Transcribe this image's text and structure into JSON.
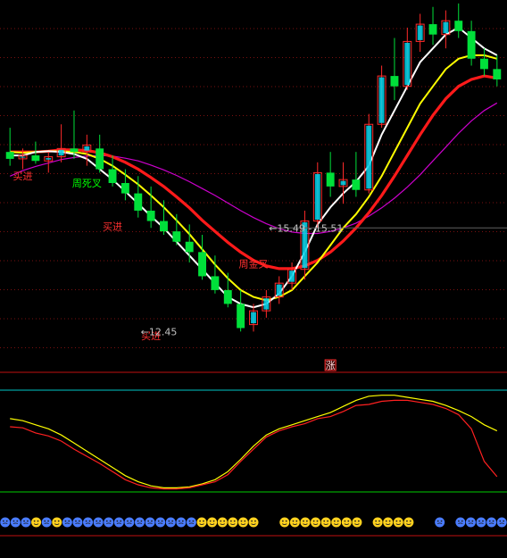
{
  "chart_data": [
    {
      "type": "candlestick",
      "panel": "main",
      "colors": {
        "up": "#ff2a2a",
        "down": "#00e03a",
        "up_bar_fill": "#00d8f0",
        "signal_bar": "#ffff00"
      },
      "candles": [
        {
          "o": 15.05,
          "h": 15.4,
          "l": 14.85,
          "c": 14.95
        },
        {
          "o": 14.95,
          "h": 15.1,
          "l": 14.8,
          "c": 15.0
        },
        {
          "o": 15.0,
          "h": 15.2,
          "l": 14.88,
          "c": 14.92
        },
        {
          "o": 14.92,
          "h": 15.05,
          "l": 14.75,
          "c": 14.98
        },
        {
          "o": 14.98,
          "h": 15.45,
          "l": 14.9,
          "c": 15.1
        },
        {
          "o": 15.1,
          "h": 15.65,
          "l": 14.95,
          "c": 15.05
        },
        {
          "o": 15.05,
          "h": 15.3,
          "l": 14.85,
          "c": 15.15
        },
        {
          "o": 15.1,
          "h": 15.3,
          "l": 14.75,
          "c": 14.8
        },
        {
          "o": 14.8,
          "h": 15.0,
          "l": 14.55,
          "c": 14.6
        },
        {
          "o": 14.6,
          "h": 14.8,
          "l": 14.35,
          "c": 14.45
        },
        {
          "o": 14.45,
          "h": 14.7,
          "l": 14.1,
          "c": 14.2
        },
        {
          "o": 14.2,
          "h": 14.55,
          "l": 13.95,
          "c": 14.05
        },
        {
          "o": 14.05,
          "h": 14.35,
          "l": 13.85,
          "c": 13.9
        },
        {
          "o": 13.9,
          "h": 14.15,
          "l": 13.7,
          "c": 13.75
        },
        {
          "o": 13.75,
          "h": 14.0,
          "l": 13.45,
          "c": 13.6
        },
        {
          "o": 13.6,
          "h": 13.85,
          "l": 13.2,
          "c": 13.25
        },
        {
          "o": 13.25,
          "h": 13.55,
          "l": 13.0,
          "c": 13.05
        },
        {
          "o": 13.05,
          "h": 13.3,
          "l": 12.8,
          "c": 12.85
        },
        {
          "o": 12.85,
          "h": 13.05,
          "l": 12.45,
          "c": 12.5
        },
        {
          "o": 12.55,
          "h": 12.85,
          "l": 12.45,
          "c": 12.75
        },
        {
          "o": 12.75,
          "h": 13.05,
          "l": 12.65,
          "c": 12.95
        },
        {
          "o": 12.95,
          "h": 13.25,
          "l": 12.85,
          "c": 13.15
        },
        {
          "o": 13.15,
          "h": 13.45,
          "l": 13.05,
          "c": 13.35
        },
        {
          "o": 13.35,
          "h": 14.2,
          "l": 13.2,
          "c": 14.05
        },
        {
          "o": 14.05,
          "h": 14.9,
          "l": 13.95,
          "c": 14.75
        },
        {
          "o": 14.75,
          "h": 15.05,
          "l": 14.4,
          "c": 14.55
        },
        {
          "o": 14.55,
          "h": 14.9,
          "l": 14.3,
          "c": 14.65
        },
        {
          "o": 14.65,
          "h": 15.05,
          "l": 14.4,
          "c": 14.5
        },
        {
          "o": 14.5,
          "h": 15.6,
          "l": 14.45,
          "c": 15.45
        },
        {
          "o": 15.45,
          "h": 16.3,
          "l": 15.4,
          "c": 16.15
        },
        {
          "o": 16.15,
          "h": 16.7,
          "l": 15.8,
          "c": 16.0
        },
        {
          "o": 16.0,
          "h": 16.85,
          "l": 15.95,
          "c": 16.65
        },
        {
          "o": 16.65,
          "h": 17.05,
          "l": 16.5,
          "c": 16.9
        },
        {
          "o": 16.9,
          "h": 17.15,
          "l": 16.6,
          "c": 16.75
        },
        {
          "o": 16.75,
          "h": 17.1,
          "l": 16.55,
          "c": 16.95
        },
        {
          "o": 16.95,
          "h": 17.2,
          "l": 16.7,
          "c": 16.8
        },
        {
          "o": 16.8,
          "h": 16.95,
          "l": 16.3,
          "c": 16.4
        },
        {
          "o": 16.4,
          "h": 16.55,
          "l": 16.15,
          "c": 16.25
        },
        {
          "o": 16.25,
          "h": 16.45,
          "l": 16.0,
          "c": 16.1
        }
      ],
      "moving_averages": [
        {
          "name": "MA5",
          "color": "#ffffff",
          "values": [
            15.0,
            15.0,
            15.05,
            15.06,
            15.05,
            15.02,
            14.95,
            14.8,
            14.65,
            14.48,
            14.3,
            14.12,
            13.95,
            13.75,
            13.55,
            13.35,
            13.15,
            12.95,
            12.85,
            12.8,
            12.85,
            13.0,
            13.25,
            13.6,
            14.0,
            14.25,
            14.45,
            14.62,
            14.85,
            15.3,
            15.65,
            16.0,
            16.35,
            16.55,
            16.75,
            16.85,
            16.7,
            16.55,
            16.45
          ]
        },
        {
          "name": "MA10",
          "color": "#ffff00",
          "values": [
            15.05,
            15.04,
            15.05,
            15.06,
            15.06,
            15.05,
            15.02,
            14.95,
            14.85,
            14.72,
            14.58,
            14.42,
            14.25,
            14.06,
            13.86,
            13.64,
            13.42,
            13.22,
            13.05,
            12.95,
            12.9,
            12.95,
            13.05,
            13.25,
            13.45,
            13.7,
            13.95,
            14.15,
            14.4,
            14.7,
            15.05,
            15.4,
            15.75,
            16.0,
            16.25,
            16.4,
            16.45,
            16.45,
            16.4
          ]
        },
        {
          "name": "MA20",
          "color": "#ff1a1a",
          "values": [
            15.05,
            15.05,
            15.05,
            15.06,
            15.08,
            15.08,
            15.07,
            15.04,
            14.98,
            14.9,
            14.8,
            14.68,
            14.55,
            14.4,
            14.24,
            14.06,
            13.9,
            13.74,
            13.6,
            13.48,
            13.4,
            13.36,
            13.36,
            13.4,
            13.48,
            13.6,
            13.76,
            13.95,
            14.17,
            14.42,
            14.7,
            15.0,
            15.3,
            15.58,
            15.82,
            16.0,
            16.1,
            16.15,
            16.12
          ]
        },
        {
          "name": "MA60",
          "color": "#cc00cc",
          "values": [
            14.7,
            14.78,
            14.84,
            14.89,
            14.94,
            14.97,
            14.99,
            15.0,
            14.99,
            14.96,
            14.92,
            14.86,
            14.79,
            14.71,
            14.62,
            14.52,
            14.42,
            14.31,
            14.2,
            14.1,
            14.01,
            13.94,
            13.89,
            13.87,
            13.87,
            13.9,
            13.95,
            14.02,
            14.12,
            14.24,
            14.38,
            14.54,
            14.72,
            14.92,
            15.12,
            15.32,
            15.5,
            15.65,
            15.76
          ]
        }
      ],
      "labels": [
        {
          "text": "买进",
          "idx": 1,
          "price": 14.65,
          "color": "#ff3030"
        },
        {
          "text": "周死叉",
          "idx": 6,
          "price": 14.55,
          "color": "#00ff00"
        },
        {
          "text": "买进",
          "idx": 8,
          "price": 13.92,
          "color": "#ff3030"
        },
        {
          "text": "买进",
          "idx": 11,
          "price": 12.34,
          "color": "#ff3030"
        },
        {
          "text": "周金叉",
          "idx": 19,
          "price": 13.38,
          "color": "#ff3030"
        }
      ],
      "price_markers": [
        {
          "text": "←12.45",
          "price": 12.45,
          "idx": 10,
          "color": "#c0c0c0"
        },
        {
          "text": "←15.49 - 15.51",
          "price": 13.95,
          "idx": 20,
          "color": "#c0c0c0",
          "reference_line": true
        }
      ],
      "ylim": [
        11.95,
        17.25
      ]
    },
    {
      "type": "line",
      "panel": "oscillator",
      "ylim": [
        0,
        100
      ],
      "reference_levels": [
        {
          "value": 100,
          "color": "#00c8c8"
        },
        {
          "value": 0,
          "color": "#00cc00"
        }
      ],
      "badge": "涨",
      "series": [
        {
          "color": "#ffff00",
          "values": [
            72,
            70,
            66,
            62,
            56,
            48,
            40,
            32,
            24,
            16,
            10,
            6,
            4,
            4,
            5,
            8,
            12,
            20,
            32,
            45,
            56,
            62,
            66,
            70,
            74,
            78,
            84,
            90,
            94,
            95,
            95,
            93,
            91,
            89,
            85,
            80,
            74,
            66,
            60
          ]
        },
        {
          "color": "#ff2020",
          "values": [
            64,
            63,
            58,
            55,
            50,
            42,
            35,
            28,
            20,
            12,
            7,
            4,
            3,
            3,
            4,
            7,
            10,
            17,
            30,
            42,
            54,
            60,
            64,
            67,
            72,
            74,
            79,
            85,
            86,
            89,
            90,
            90,
            88,
            86,
            82,
            76,
            62,
            30,
            15
          ]
        }
      ]
    },
    {
      "type": "icon_strip",
      "panel": "signals",
      "positive_icon": "smiley-icon",
      "negative_icon": "sad-face-icon",
      "colors": {
        "positive": "#ffd21f",
        "negative": "#4a7cff"
      },
      "states": [
        -1,
        -1,
        -1,
        1,
        -1,
        1,
        -1,
        -1,
        -1,
        -1,
        -1,
        -1,
        -1,
        -1,
        -1,
        -1,
        -1,
        -1,
        -1,
        1,
        1,
        1,
        1,
        1,
        1,
        0,
        0,
        1,
        1,
        1,
        1,
        1,
        1,
        1,
        1,
        0,
        1,
        1,
        1,
        1,
        0,
        0,
        -1,
        0,
        -1,
        -1,
        -1,
        -1,
        -1
      ]
    }
  ]
}
